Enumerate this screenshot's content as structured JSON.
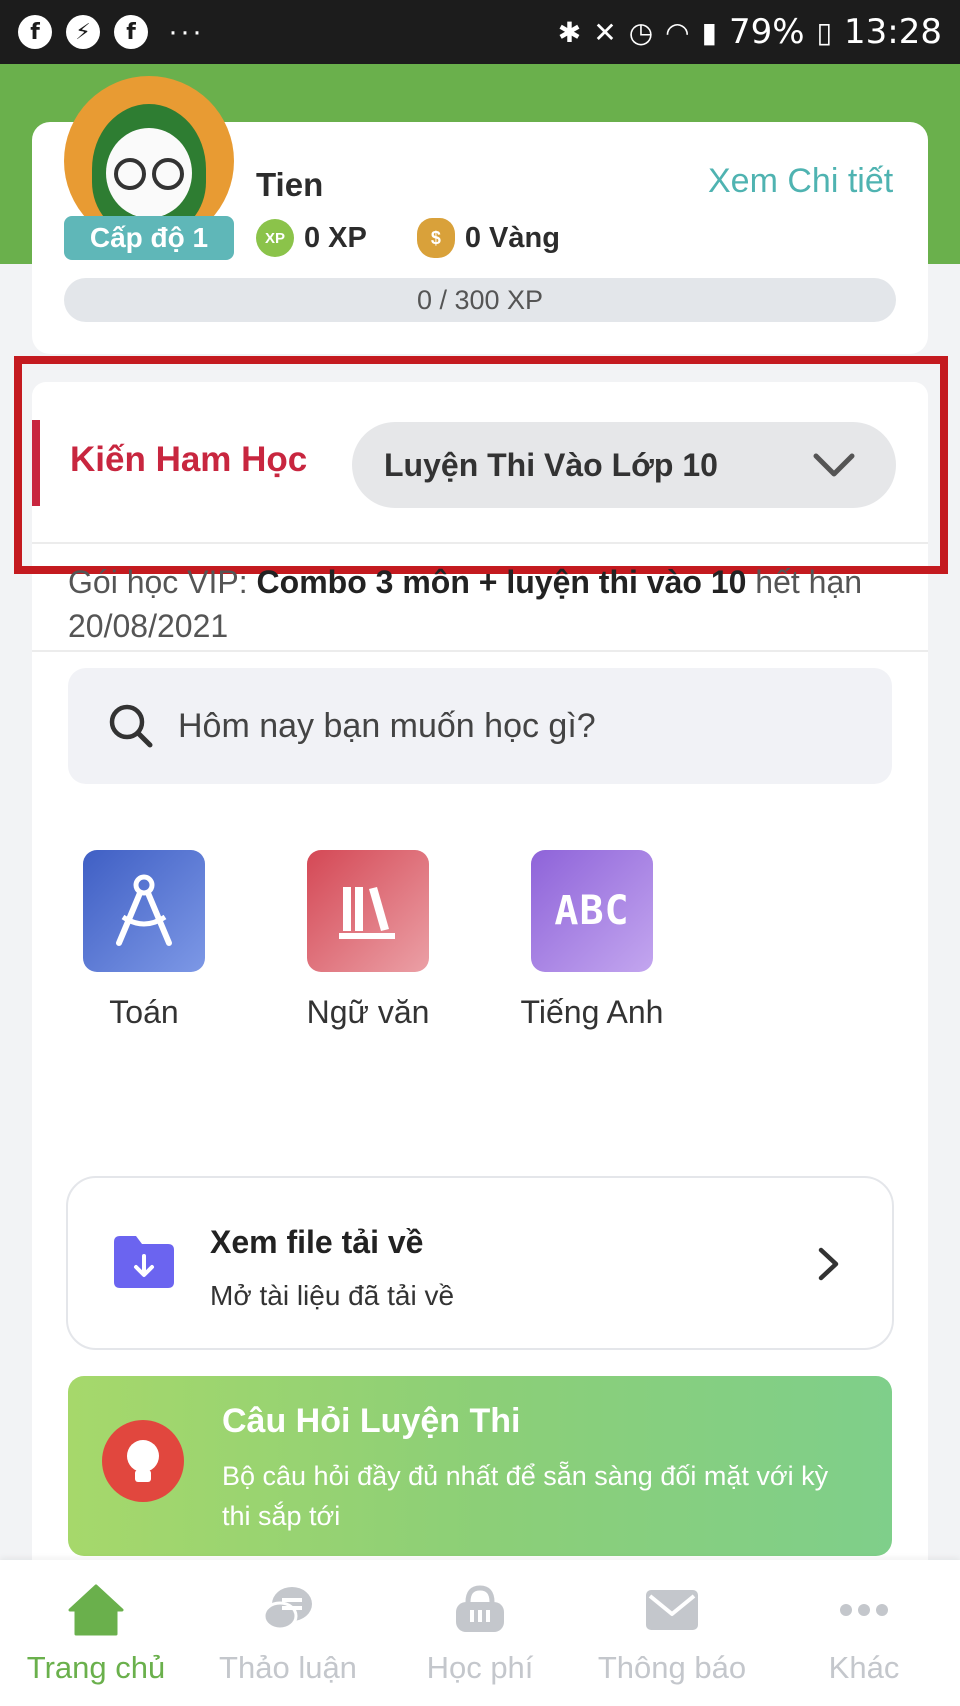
{
  "status_bar": {
    "battery": "79%",
    "time": "13:28",
    "dots": "···"
  },
  "profile": {
    "name": "Tien",
    "level": "Cấp độ 1",
    "details_link": "Xem Chi tiết",
    "xp": "0 XP",
    "gold": "0 Vàng",
    "xp_icon_text": "XP",
    "progress_text": "0 / 300 XP",
    "progress_fraction": 0.0
  },
  "school": {
    "name": "Kiến Ham Học",
    "selected_course": "Luyện Thi Vào Lớp 10"
  },
  "vip": {
    "prefix": "Gói học VIP: ",
    "package": "Combo 3 môn + luyện thi vào 10",
    "suffix": " hết hạn 20/08/2021"
  },
  "search": {
    "placeholder": "Hôm nay bạn muốn học gì?"
  },
  "subjects": [
    {
      "label": "Toán",
      "icon": "compass-icon",
      "color": "#4a66c9"
    },
    {
      "label": "Ngữ văn",
      "icon": "books-icon",
      "color": "#d9535e"
    },
    {
      "label": "Tiếng Anh",
      "icon": "abc-icon",
      "color": "#9b6fe0",
      "tile_text": "ABC"
    }
  ],
  "download": {
    "title": "Xem file tải về",
    "subtitle": "Mở tài liệu đã tải về"
  },
  "promo": {
    "title": "Câu Hỏi Luyện Thi",
    "description": "Bộ câu hỏi đầy đủ nhất để sẵn sàng đối mặt với kỳ thi sắp tới"
  },
  "nav": [
    {
      "label": "Trang chủ",
      "icon": "home-icon",
      "active": true
    },
    {
      "label": "Thảo luận",
      "icon": "chat-icon",
      "active": false
    },
    {
      "label": "Học phí",
      "icon": "basket-icon",
      "active": false
    },
    {
      "label": "Thông báo",
      "icon": "mail-icon",
      "active": false
    },
    {
      "label": "Khác",
      "icon": "more-icon",
      "active": false
    }
  ],
  "colors": {
    "brand_green": "#6ab04c",
    "accent_teal": "#4fb3b1",
    "school_red": "#c8263f",
    "highlight_frame": "#c41a1f"
  }
}
